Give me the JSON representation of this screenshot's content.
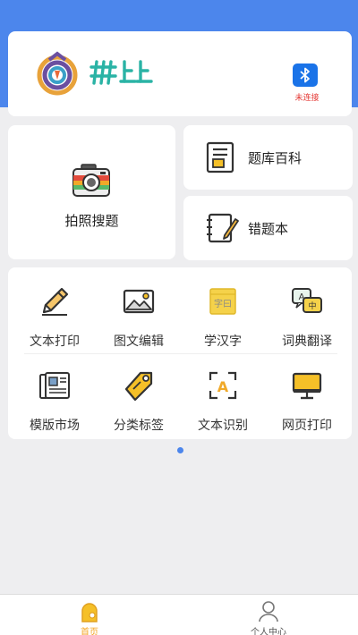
{
  "header": {
    "bluetooth_status": "未连接"
  },
  "features": {
    "photo_search": "拍照搜题",
    "question_bank": "题库百科",
    "wrong_book": "错题本"
  },
  "tools": [
    {
      "label": "文本打印",
      "icon": "pencil-icon"
    },
    {
      "label": "图文编辑",
      "icon": "image-icon"
    },
    {
      "label": "学汉字",
      "icon": "chinese-character-icon"
    },
    {
      "label": "词典翻译",
      "icon": "translate-icon"
    },
    {
      "label": "模版市场",
      "icon": "newspaper-icon"
    },
    {
      "label": "分类标签",
      "icon": "tag-icon"
    },
    {
      "label": "文本识别",
      "icon": "text-scan-icon"
    },
    {
      "label": "网页打印",
      "icon": "monitor-icon"
    }
  ],
  "tabbar": {
    "home": "首页",
    "profile": "个人中心"
  },
  "colors": {
    "accent": "#4c86ec",
    "active_tab": "#f5a623",
    "bluetooth": "#1a73e8",
    "disconnected": "#e53935"
  }
}
